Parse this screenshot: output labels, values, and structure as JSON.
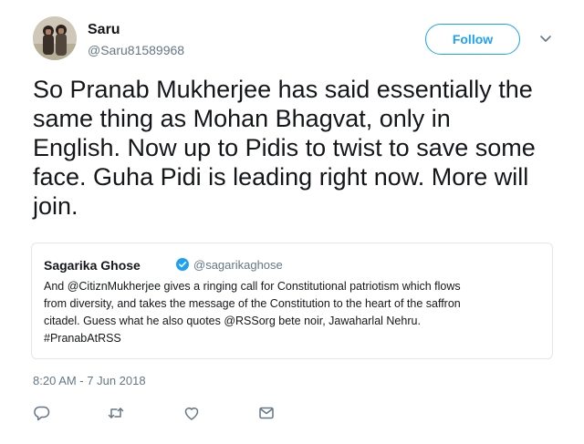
{
  "author": {
    "display_name": "Saru",
    "handle": "@Saru81589968"
  },
  "follow_button": {
    "label": "Follow"
  },
  "tweet": {
    "text": "So Pranab Mukherjee has said essentially the\nsame thing as Mohan Bhagvat, only in\nEnglish. Now up to Pidis to twist to save some\nface. Guha Pidi is leading right now. More will\njoin.",
    "timestamp": "8:20 AM - 7 Jun 2018"
  },
  "quoted_tweet": {
    "display_name": "Sagarika Ghose",
    "handle": "@sagarikaghose",
    "verified_icon": "verified-badge",
    "text": "And @CitiznMukherjee gives a ringing call for Constitutional patriotism which flows\nfrom diversity, and takes the message of the Constitution to the heart of the saffron\ncitadel. Guess what he also quotes @RSSorg bete noir, Jawaharlal Nehru.\n#PranabAtRSS"
  },
  "actions": {
    "reply_icon": "speech-bubble",
    "retweet_icon": "retweet-arrows",
    "like_icon": "heart",
    "dm_icon": "envelope"
  },
  "colors": {
    "accent": "#1da1f2",
    "text_primary": "#14171a",
    "text_secondary": "#657786",
    "border": "#e1e8ed"
  }
}
